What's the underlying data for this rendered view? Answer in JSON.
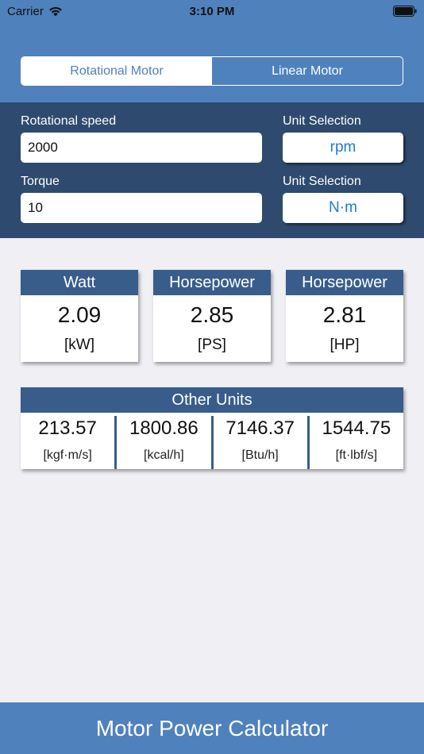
{
  "status_bar": {
    "carrier": "Carrier",
    "time": "3:10 PM"
  },
  "tabs": [
    {
      "label": "Rotational Motor",
      "active": true
    },
    {
      "label": "Linear Motor",
      "active": false
    }
  ],
  "inputs": {
    "speed": {
      "label": "Rotational speed",
      "value": "2000",
      "unit_label": "Unit Selection",
      "unit": "rpm"
    },
    "torque": {
      "label": "Torque",
      "value": "10",
      "unit_label": "Unit Selection",
      "unit": "N·m"
    }
  },
  "results": [
    {
      "title": "Watt",
      "value": "2.09",
      "unit": "[kW]"
    },
    {
      "title": "Horsepower",
      "value": "2.85",
      "unit": "[PS]"
    },
    {
      "title": "Horsepower",
      "value": "2.81",
      "unit": "[HP]"
    }
  ],
  "other_units": {
    "title": "Other Units",
    "items": [
      {
        "value": "213.57",
        "unit": "[kgf·m/s]"
      },
      {
        "value": "1800.86",
        "unit": "[kcal/h]"
      },
      {
        "value": "7146.37",
        "unit": "[Btu/h]"
      },
      {
        "value": "1544.75",
        "unit": "[ft·lbf/s]"
      }
    ]
  },
  "footer": {
    "title": "Motor Power Calculator"
  },
  "colors": {
    "primary": "#4f81bd",
    "panel": "#2e4a6e",
    "header": "#385d8a",
    "accent": "#1a7ad9",
    "background": "#efeff4"
  }
}
